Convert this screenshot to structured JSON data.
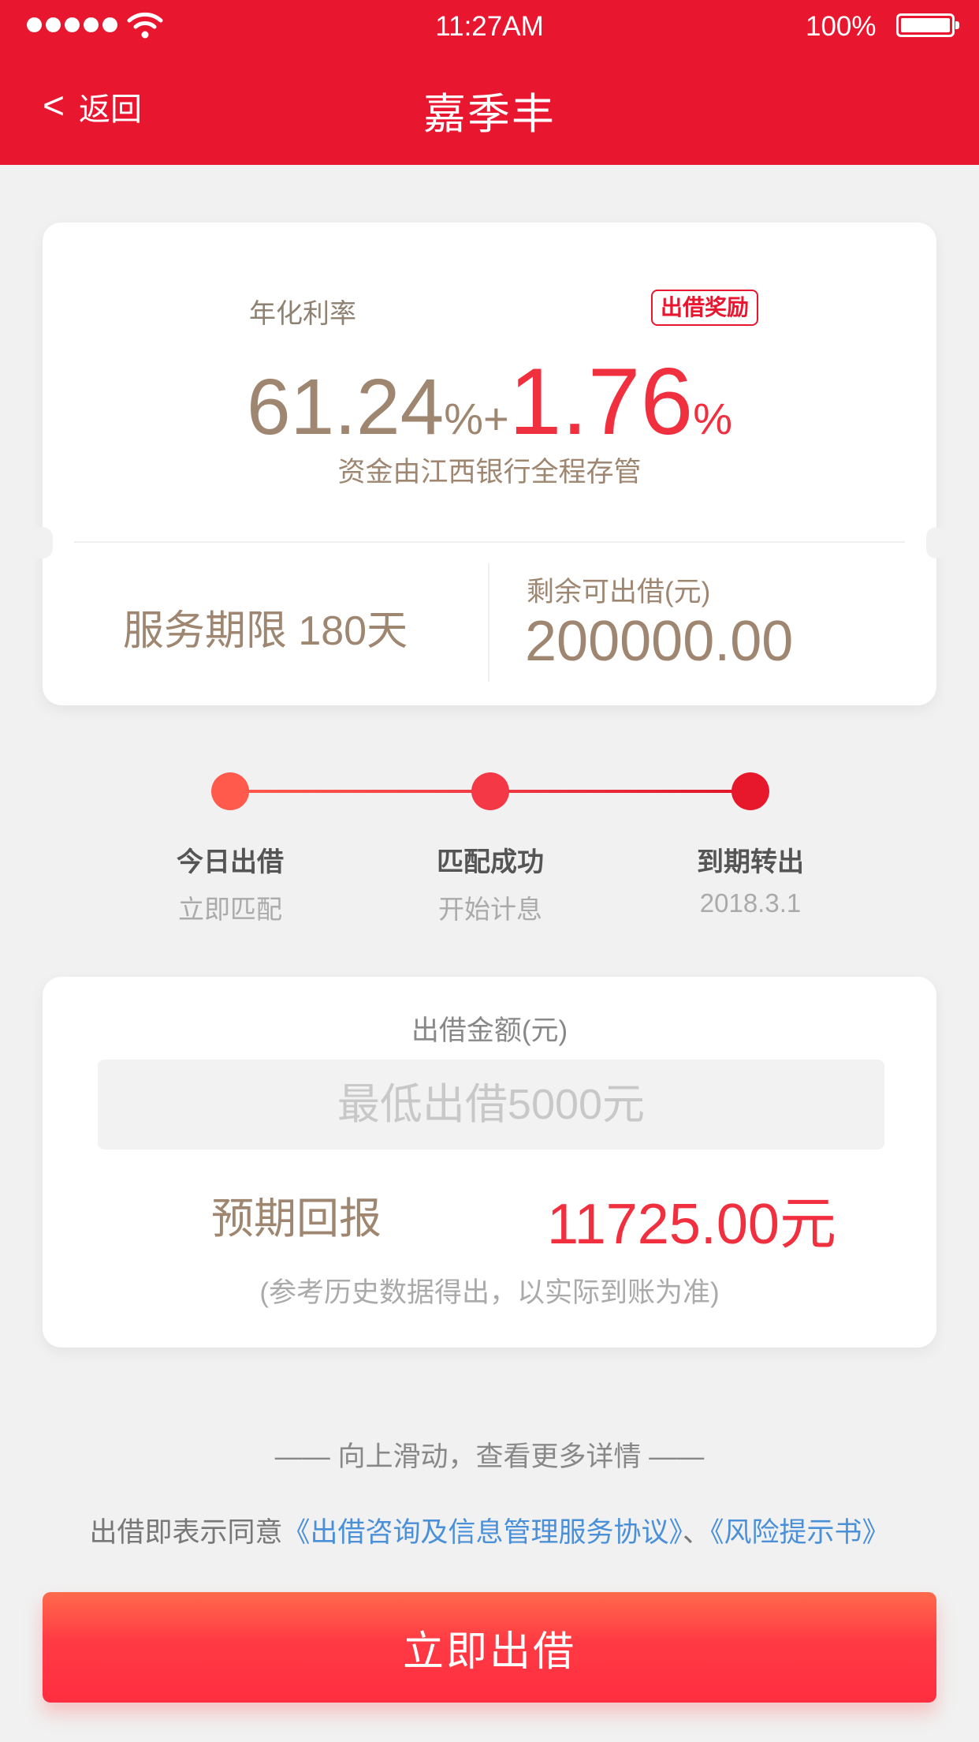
{
  "status_bar": {
    "time": "11:27AM",
    "battery": "100%"
  },
  "nav": {
    "back_label": "返回",
    "back_glyph": "<",
    "title": "嘉季丰"
  },
  "product": {
    "rate_label": "年化利率",
    "reward_badge": "出借奖励",
    "base_rate": "61.24",
    "unit": "%",
    "plus": "+",
    "bonus_rate": "1.76",
    "custody_note": "资金由江西银行全程存管",
    "term": "服务期限 180天",
    "remaining_label": "剩余可出借(元)",
    "remaining_value": "200000.00"
  },
  "timeline": {
    "steps": [
      {
        "title": "今日出借",
        "sub": "立即匹配"
      },
      {
        "title": "匹配成功",
        "sub": "开始计息"
      },
      {
        "title": "到期转出",
        "sub": "2018.3.1"
      }
    ]
  },
  "invest_form": {
    "amount_label": "出借金额(元)",
    "amount_placeholder": "最低出借5000元",
    "amount_value": "",
    "return_label": "预期回报",
    "return_value": "11725.00元",
    "note": "(参考历史数据得出，以实际到账为准)"
  },
  "footer": {
    "swipe_hint": "—— 向上滑动，查看更多详情 ——",
    "agree_prefix": "出借即表示同意",
    "agreement_link": "《出借咨询及信息管理服务协议》",
    "separator": "、",
    "risk_link": "《风险提示书》",
    "button_label": "立即出借"
  },
  "colors": {
    "brand_red": "#e8162f",
    "accent_red": "#f0303f",
    "gold": "#9e8670",
    "link_blue": "#4a90d9"
  },
  "icons": {
    "signal": "signal-dots-icon",
    "wifi": "wifi-icon",
    "battery": "battery-icon",
    "back": "chevron-left-icon"
  }
}
